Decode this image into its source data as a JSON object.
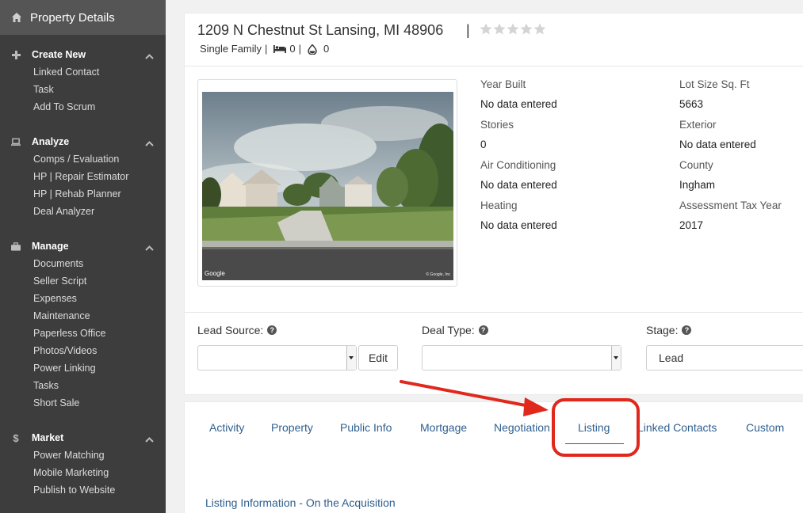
{
  "sidebar": {
    "title": "Property Details",
    "sections": [
      {
        "title": "Create New",
        "items": [
          "Linked Contact",
          "Task",
          "Add To Scrum"
        ]
      },
      {
        "title": "Analyze",
        "items": [
          "Comps / Evaluation",
          "HP | Repair Estimator",
          "HP | Rehab Planner",
          "Deal Analyzer"
        ]
      },
      {
        "title": "Manage",
        "items": [
          "Documents",
          "Seller Script",
          "Expenses",
          "Maintenance",
          "Paperless Office",
          "Photos/Videos",
          "Power Linking",
          "Tasks",
          "Short Sale"
        ]
      },
      {
        "title": "Market",
        "items": [
          "Power Matching",
          "Mobile Marketing",
          "Publish to Website"
        ]
      }
    ]
  },
  "property": {
    "address": "1209 N Chestnut St Lansing, MI 48906",
    "separator": "|",
    "type": "Single Family",
    "meta_sep": "|",
    "beds": "0",
    "baths": "0",
    "rating_stars": 0,
    "rating_max": 5
  },
  "photo": {
    "watermark_left": "Google",
    "watermark_right": "© Google, Inc"
  },
  "details": {
    "left": [
      {
        "label": "Year Built",
        "value": "No data entered"
      },
      {
        "label": "Stories",
        "value": "0"
      },
      {
        "label": "Air Conditioning",
        "value": "No data entered"
      },
      {
        "label": "Heating",
        "value": "No data entered"
      }
    ],
    "right": [
      {
        "label": "Lot Size Sq. Ft",
        "value": "5663"
      },
      {
        "label": "Exterior",
        "value": "No data entered"
      },
      {
        "label": "County",
        "value": "Ingham"
      },
      {
        "label": "Assessment Tax Year",
        "value": "2017"
      }
    ]
  },
  "form": {
    "lead_source_label": "Lead Source:",
    "lead_source_value": "",
    "edit_label": "Edit",
    "deal_type_label": "Deal Type:",
    "deal_type_value": "",
    "stage_label": "Stage:",
    "stage_value": "Lead",
    "help_glyph": "?"
  },
  "tabs": [
    {
      "label": "Activity"
    },
    {
      "label": "Property"
    },
    {
      "label": "Public Info"
    },
    {
      "label": "Mortgage"
    },
    {
      "label": "Negotiation"
    },
    {
      "label": "Listing"
    },
    {
      "label": "Linked Contacts"
    },
    {
      "label": "Custom"
    }
  ],
  "active_tab": "Listing",
  "section_link": "Listing Information - On the Acquisition",
  "colors": {
    "sidebar_bg": "#3d3d3d",
    "sidebar_header": "#555555",
    "link_blue": "#2f5f8f",
    "annotation_red": "#e0281c"
  }
}
